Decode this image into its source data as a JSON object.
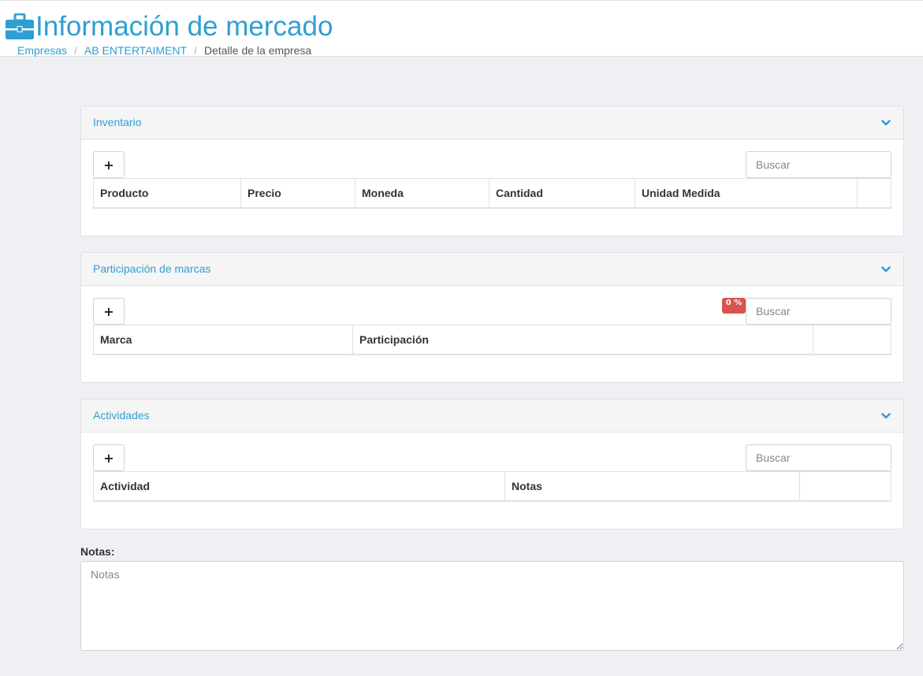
{
  "header": {
    "title": "Información de mercado",
    "icon": "briefcase-icon",
    "accent_color": "#2e9fd2"
  },
  "breadcrumb": {
    "items": [
      "Empresas",
      "AB ENTERTAIMENT",
      "Detalle de la empresa"
    ],
    "separator": "/"
  },
  "panels": {
    "inventario": {
      "title": "Inventario",
      "add_label": "+",
      "search_placeholder": "Buscar",
      "columns": [
        "Producto",
        "Precio",
        "Moneda",
        "Cantidad",
        "Unidad Medida",
        ""
      ]
    },
    "marcas": {
      "title": "Participación de marcas",
      "add_label": "+",
      "badge": "0 %",
      "badge_color": "#d9534f",
      "search_placeholder": "Buscar",
      "columns": [
        "Marca",
        "Participación",
        ""
      ]
    },
    "actividades": {
      "title": "Actividades",
      "add_label": "+",
      "search_placeholder": "Buscar",
      "columns": [
        "Actividad",
        "Notas",
        ""
      ]
    }
  },
  "notes": {
    "label": "Notas:",
    "placeholder": "Notas"
  }
}
